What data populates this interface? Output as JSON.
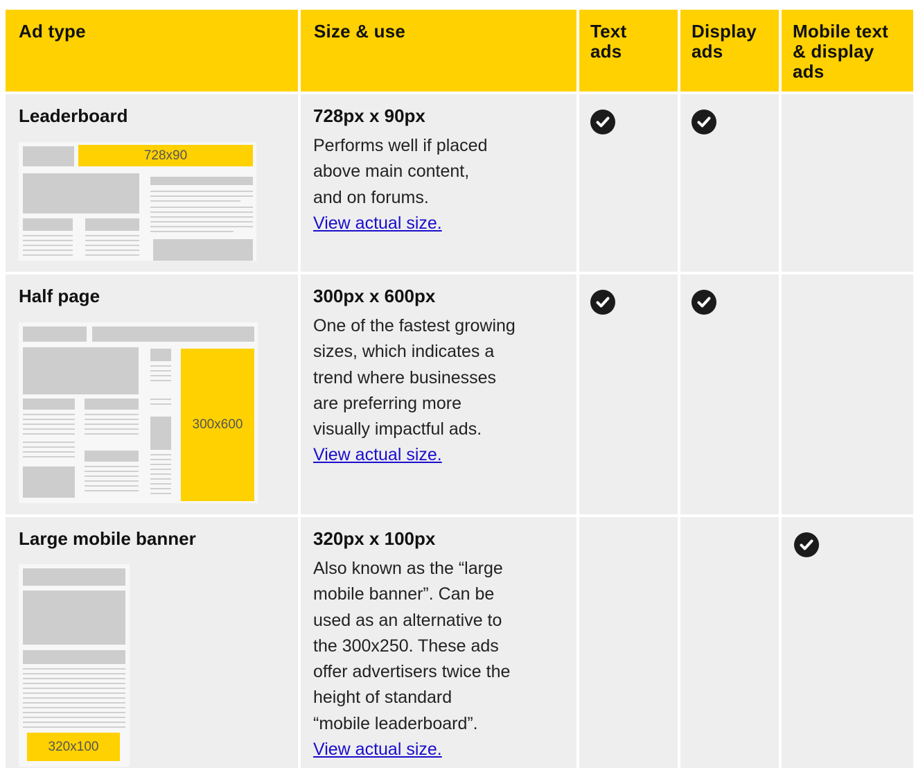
{
  "header": {
    "ad_type": "Ad type",
    "size_use": "Size & use",
    "text_ads": [
      "Text",
      "ads"
    ],
    "display_ads": [
      "Display",
      "ads"
    ],
    "mobile_ads": [
      "Mobile text",
      "& display",
      "ads"
    ]
  },
  "rows": [
    {
      "name": "Leaderboard",
      "size": "728px x 90px",
      "desc": [
        "Performs well if placed",
        "above main content,",
        "and on forums."
      ],
      "link": "View actual size.",
      "thumb_label": "728x90",
      "text_ads": true,
      "display_ads": true,
      "mobile_ads": false
    },
    {
      "name": "Half page",
      "size": "300px x 600px",
      "desc": [
        "One of the fastest growing",
        "sizes, which indicates a",
        "trend where businesses",
        "are preferring more",
        "visually impactful ads."
      ],
      "link": "View actual size.",
      "thumb_label": "300x600",
      "text_ads": true,
      "display_ads": true,
      "mobile_ads": false
    },
    {
      "name": "Large mobile banner",
      "size": "320px x 100px",
      "desc": [
        "Also known as the “large",
        "mobile banner”. Can be",
        "used as an alternative to",
        "the 300x250. These ads",
        "offer advertisers twice the",
        "height of standard",
        "“mobile leaderboard”."
      ],
      "link": "View actual size.",
      "thumb_label": "320x100",
      "text_ads": false,
      "display_ads": false,
      "mobile_ads": true
    }
  ],
  "colors": {
    "header_bg": "#ffd100",
    "row_bg": "#eeeeee",
    "link": "#1a0dcc",
    "check": "#1b1b1b"
  },
  "icons": {
    "check": "check-circle-icon"
  }
}
